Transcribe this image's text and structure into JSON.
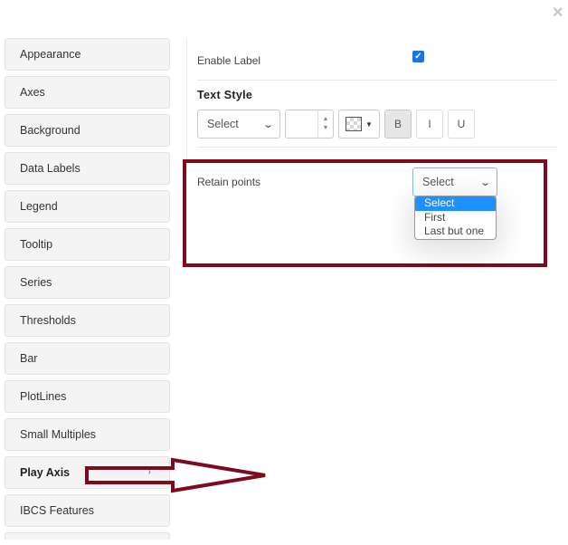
{
  "dialog": {
    "close_icon": "✕"
  },
  "sidebar": {
    "items": [
      {
        "label": "Appearance",
        "active": false
      },
      {
        "label": "Axes",
        "active": false
      },
      {
        "label": "Background",
        "active": false
      },
      {
        "label": "Data Labels",
        "active": false
      },
      {
        "label": "Legend",
        "active": false
      },
      {
        "label": "Tooltip",
        "active": false
      },
      {
        "label": "Series",
        "active": false
      },
      {
        "label": "Thresholds",
        "active": false
      },
      {
        "label": "Bar",
        "active": false
      },
      {
        "label": "PlotLines",
        "active": false
      },
      {
        "label": "Small Multiples",
        "active": false
      },
      {
        "label": "Play Axis",
        "active": true
      },
      {
        "label": "IBCS Features",
        "active": false
      }
    ],
    "active_caret": "›"
  },
  "panel": {
    "enable_label": {
      "label": "Enable Label",
      "checked": true,
      "check_glyph": "✓"
    },
    "text_style": {
      "title": "Text Style",
      "font_select": {
        "value": "Select",
        "chevron": "⌄"
      },
      "font_size": {
        "value": "",
        "up": "▲",
        "down": "▼"
      },
      "color": {
        "caret": "▼"
      },
      "bold": {
        "label": "B",
        "active": true
      },
      "italic": {
        "label": "I",
        "active": false
      },
      "underline": {
        "label": "U",
        "active": false
      }
    },
    "retain_points": {
      "label": "Retain points",
      "value": "Select",
      "chevron": "⌄",
      "options": [
        {
          "label": "Select",
          "selected": true
        },
        {
          "label": "First",
          "selected": false
        },
        {
          "label": "Last but one",
          "selected": false
        }
      ]
    }
  },
  "annotations": {
    "highlight_color": "#7d0a1d"
  }
}
